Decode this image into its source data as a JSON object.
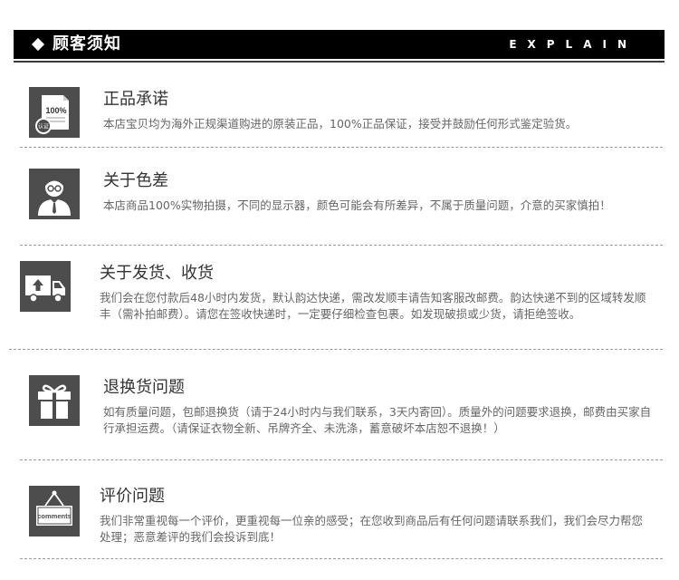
{
  "header": {
    "title": "顾客须知",
    "subtitle": "EXPLAIN"
  },
  "items": [
    {
      "title": "正品承诺",
      "desc": "本店宝贝均为海外正规渠道购进的原装正品，100%正品保证，接受并鼓励任何形式鉴定验货。",
      "icon": "certificate-icon",
      "icon_text": "100%",
      "icon_badge": "认证"
    },
    {
      "title": "关于色差",
      "desc": "本店商品100%实物拍摄，不同的显示器，颜色可能会有所差异，不属于质量问题，介意的买家慎拍！",
      "icon": "person-icon"
    },
    {
      "title": "关于发货、收货",
      "desc": "我们会在您付款后48小时内发货，默认韵达快递，需改发顺丰请告知客服改邮费。韵达快递不到的区域转发顺丰（需补拍邮费）。请您在签收快递时，一定要仔细检查包裹。如发现破损或少货，请拒绝签收。",
      "icon": "delivery-truck-icon"
    },
    {
      "title": "退换货问题",
      "desc": "如有质量问题，包邮退换货（请于24小时内与我们联系，3天内寄回）。质量外的问题要求退换，邮费由买家自行承担运费。（请保证衣物全新、吊牌齐全、未洗涤，蓄意破坏本店恕不退换！）",
      "icon": "gift-box-icon"
    },
    {
      "title": "评价问题",
      "desc": "我们非常重视每一个评价，更重视每一位亲的感受；在您收到商品后有任何问题请联系我们，我们会尽力帮您处理；恶意差评的我们会投诉到底！",
      "icon": "comments-sign-icon",
      "icon_text": "comments"
    }
  ]
}
